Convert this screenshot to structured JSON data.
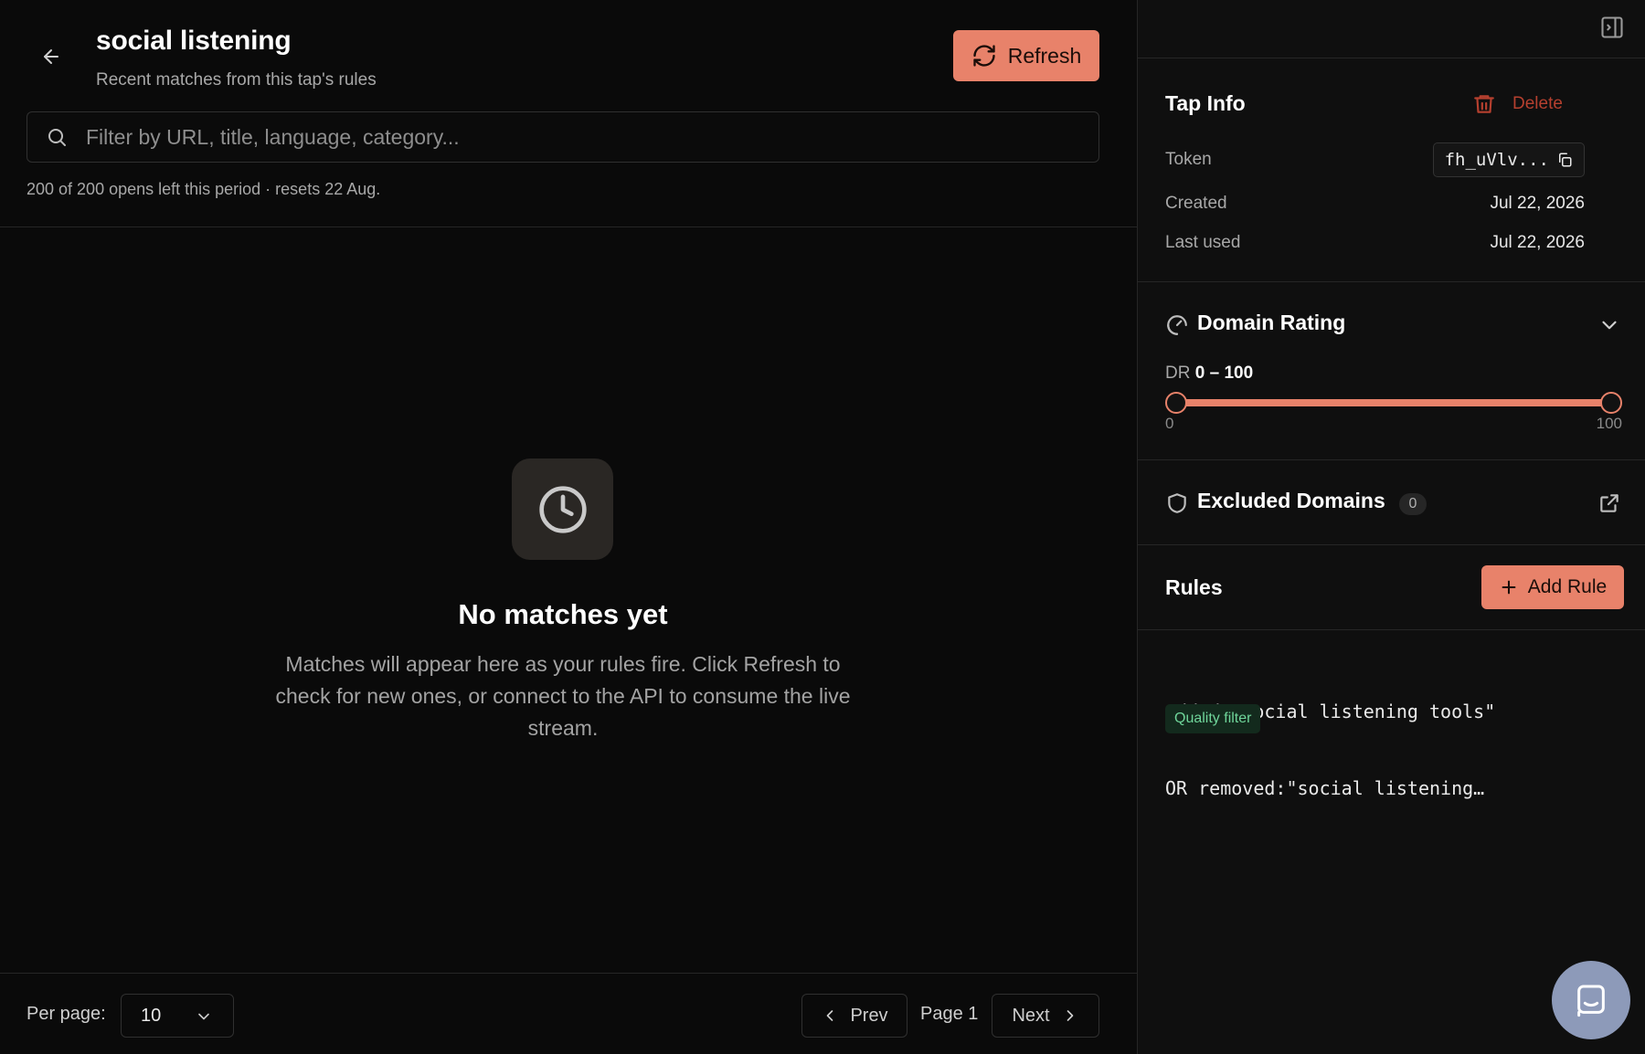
{
  "header": {
    "title": "social listening",
    "subtitle": "Recent matches from this tap's rules",
    "refresh_label": "Refresh"
  },
  "search": {
    "placeholder": "Filter by URL, title, language, category...",
    "value": ""
  },
  "quota_text": "200 of 200 opens left this period · resets 22 Aug.",
  "empty_state": {
    "icon": "clock-icon",
    "title": "No matches yet",
    "description": "Matches will appear here as your rules fire. Click Refresh to check for new ones, or connect to the API to consume the live stream."
  },
  "pagination": {
    "per_page_label": "Per page:",
    "per_page_value": "10",
    "prev_label": "Prev",
    "page_label": "Page 1",
    "next_label": "Next"
  },
  "sidebar": {
    "tap_info": {
      "title": "Tap Info",
      "delete_label": "Delete",
      "token_label": "Token",
      "token_value": "fh_uVlv...",
      "created_label": "Created",
      "created_value": "Jul 22, 2026",
      "last_used_label": "Last used",
      "last_used_value": "Jul 22, 2026"
    },
    "domain_rating": {
      "title": "Domain Rating",
      "prefix": "DR",
      "min_value": "0",
      "separator": "–",
      "max_value": "100",
      "range_min": 0,
      "range_max": 100,
      "selected_min": 0,
      "selected_max": 100,
      "tick_min": "0",
      "tick_max": "100"
    },
    "excluded_domains": {
      "title": "Excluded Domains",
      "count": "0"
    },
    "rules": {
      "title": "Rules",
      "add_label": "Add Rule",
      "items": [
        {
          "line1": "added:\"social listening tools\"",
          "line2": "OR removed:\"social listening…",
          "badge": "Quality filter"
        }
      ]
    }
  },
  "colors": {
    "accent": "#e8826a",
    "background": "#0a0a0a",
    "sidebar_bg": "#0f0f0f",
    "danger": "#b6402f",
    "success_badge_bg": "#132a1d",
    "success_badge_text": "#6fd59a",
    "chat_launcher": "#8d9ab9"
  }
}
